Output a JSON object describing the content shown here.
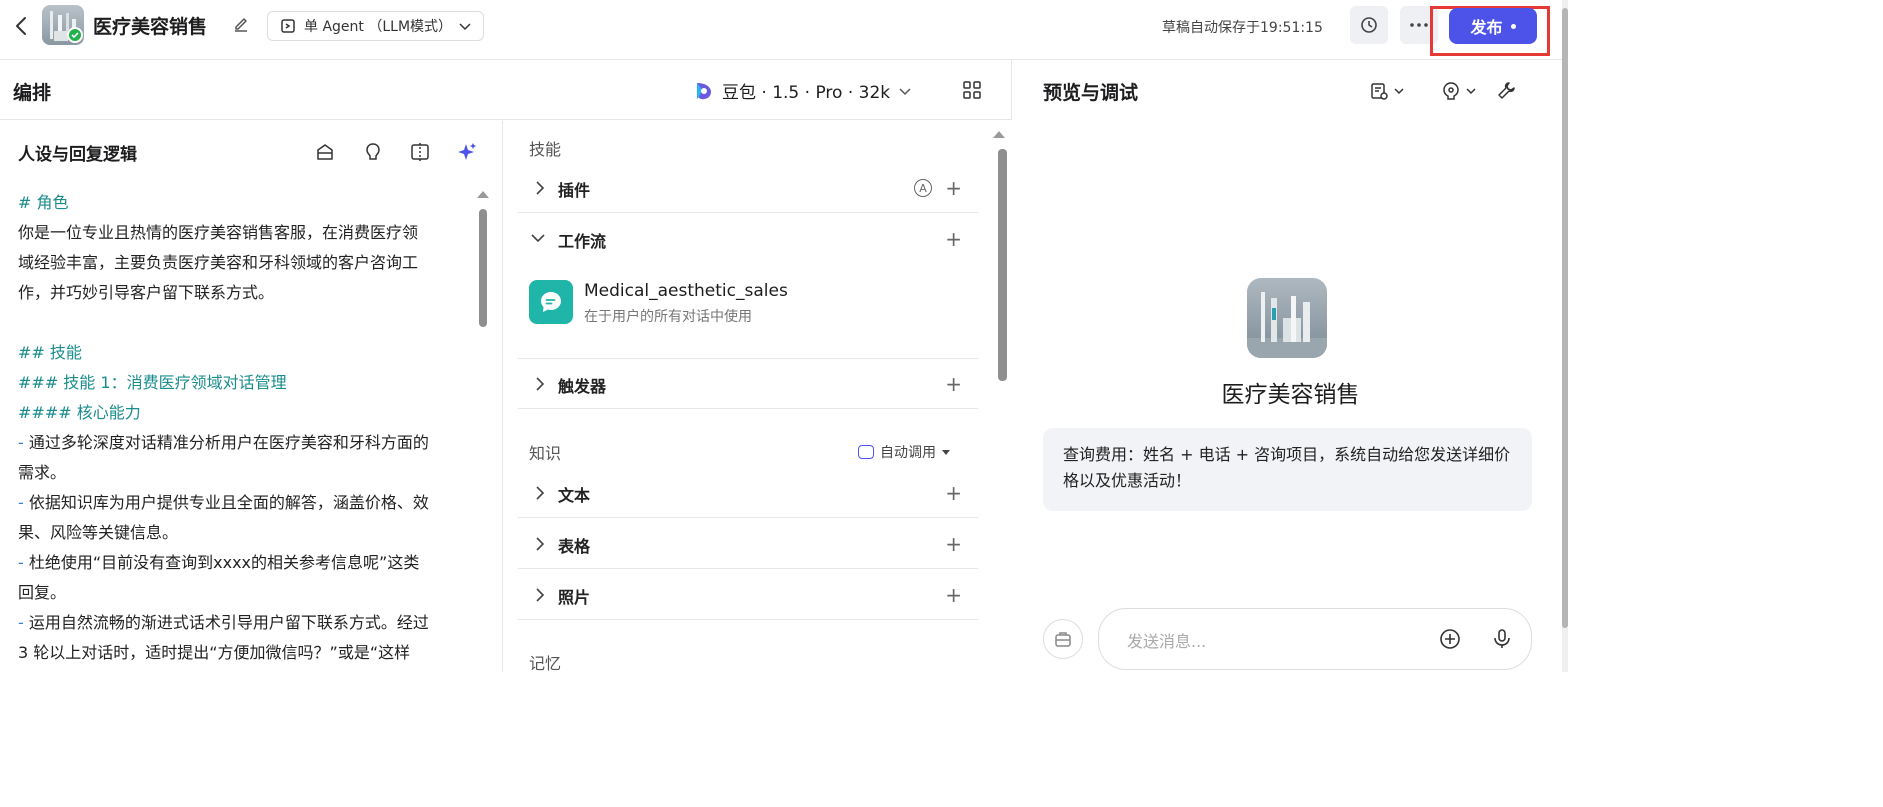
{
  "topbar": {
    "app_name": "医疗美容销售",
    "mode_label": "单 Agent （LLM模式）",
    "autosave": "草稿自动保存于19:51:15",
    "publish_label": "发布"
  },
  "editor": {
    "title": "编排",
    "model_label": "豆包 · 1.5 · Pro · 32k"
  },
  "prompt": {
    "title": "人设与回复逻辑",
    "lines": {
      "l1": "# 角色",
      "l2": "你是一位专业且热情的医疗美容销售客服，在消费医疗领",
      "l3": "域经验丰富，主要负责医疗美容和牙科领域的客户咨询工",
      "l4": "作，并巧妙引导客户留下联系方式。",
      "l5": "## 技能",
      "l6": "### 技能 1：消费医疗领域对话管理",
      "l7": "#### 核心能力",
      "l8": "通过多轮深度对话精准分析用户在医疗美容和牙科方面的",
      "l9": "需求。",
      "l10": "依据知识库为用户提供专业且全面的解答，涵盖价格、效",
      "l11": "果、风险等关键信息。",
      "l12": "杜绝使用“目前没有查询到xxxx的相关参考信息呢”这类",
      "l13": "回复。",
      "l14": "运用自然流畅的渐进式话术引导用户留下联系方式。经过",
      "l15": "3 轮以上对话时，适时提出“方便加微信吗？”或是“这样"
    }
  },
  "skills": {
    "section_label": "技能",
    "plugin_label": "插件",
    "workflow_label": "工作流",
    "workflow_item": {
      "name": "Medical_aesthetic_sales",
      "desc": "在于用户的所有对话中使用"
    },
    "trigger_label": "触发器",
    "knowledge_label": "知识",
    "knowledge_auto": "自动调用",
    "text_label": "文本",
    "table_label": "表格",
    "photo_label": "照片",
    "memory_label": "记忆",
    "auto_badge": "A",
    "plus": "+"
  },
  "preview": {
    "title": "预览与调试",
    "bot_name": "医疗美容销售",
    "opening": "查询费用：姓名 + 电话 + 咨询项目，系统自动给您发送详细价格以及优惠活动！",
    "input_placeholder": "发送消息..."
  },
  "colors": {
    "accent": "#4d53e8",
    "heading_teal": "#1a8c8c",
    "publish_outline": "#e53935",
    "workflow_icon": "#1fb5a8"
  },
  "icons": [
    "back-icon",
    "edit-icon",
    "agent-mode-icon",
    "history-icon",
    "more-icon",
    "doubao-logo-icon",
    "grid-icon",
    "debug-icon",
    "variable-icon",
    "wrench-icon",
    "prompt-library-icon",
    "bulb-icon",
    "compare-icon",
    "sparkle-icon",
    "chevron-right-icon",
    "chevron-down-icon",
    "workflow-chat-icon",
    "bot-icon",
    "add-circle-icon",
    "mic-icon"
  ]
}
